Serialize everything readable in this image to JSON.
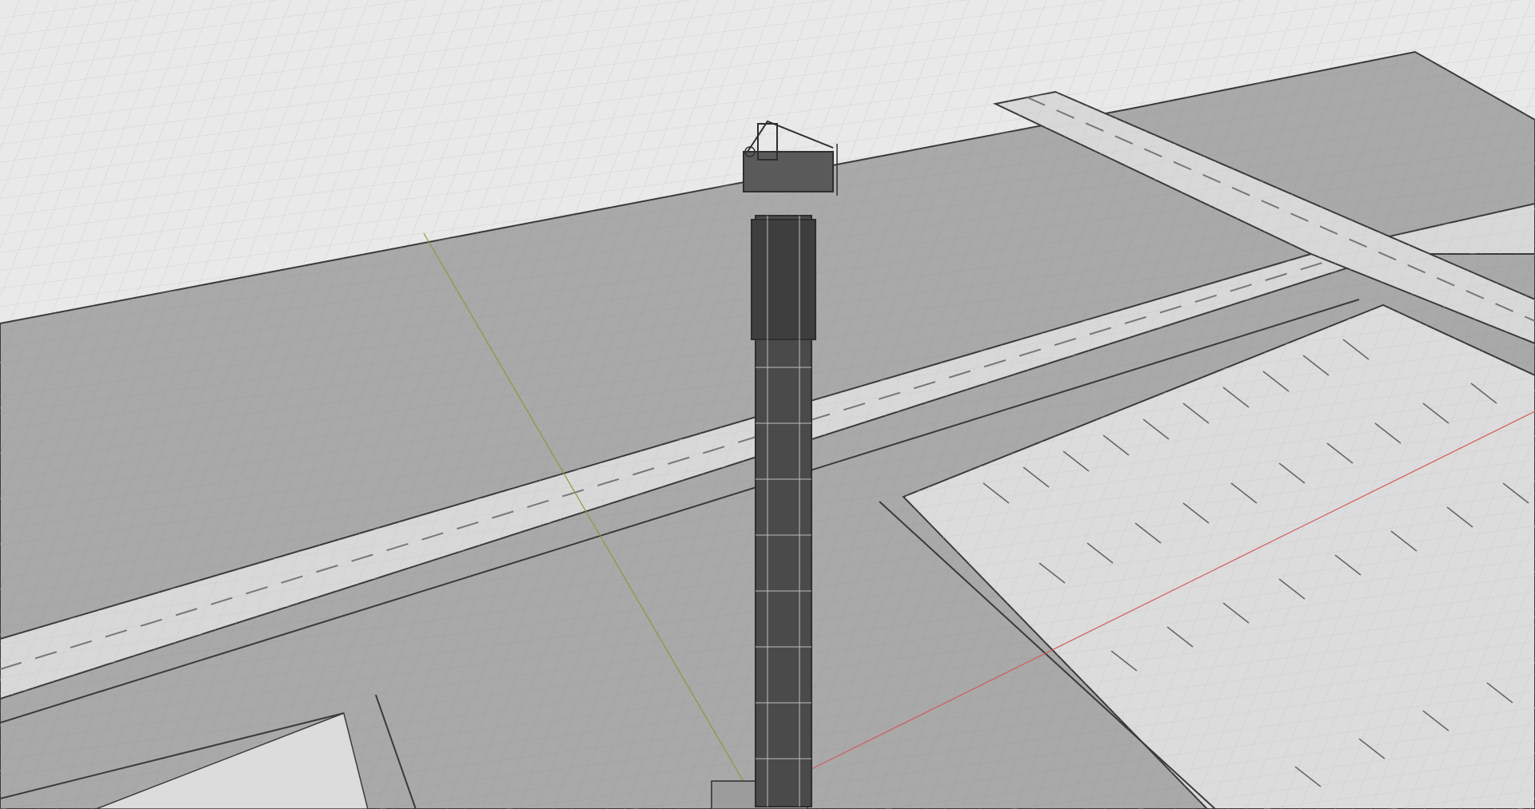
{
  "viewport": {
    "background": "#e9e9e9",
    "grid_color": "#cfcfcf",
    "major_grid_color": "#bdbdbd",
    "ground_dark": "#a6a6a6",
    "ground_light": "#dadada",
    "edge_color": "#3a3a3a",
    "axis_x_color": "#d45a5a",
    "axis_y_color": "#8a9a3a",
    "tower_color": "#2e2e2e",
    "display_mode": "wireframe"
  }
}
